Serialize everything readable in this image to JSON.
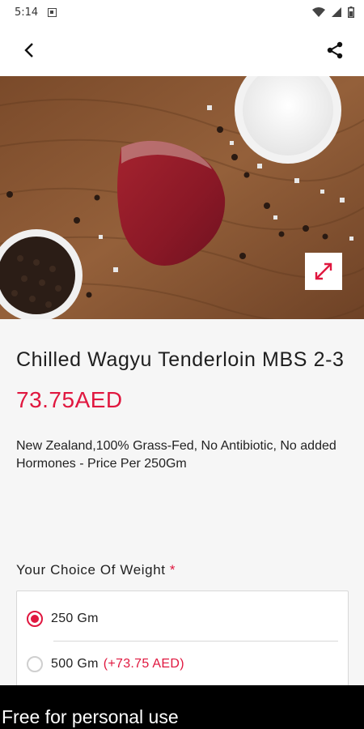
{
  "status_bar": {
    "time": "5:14",
    "icons": [
      "notification-icon",
      "wifi-icon",
      "signal-icon",
      "battery-icon"
    ]
  },
  "app_bar": {
    "back_icon": "arrow-back-icon",
    "share_icon": "share-icon"
  },
  "hero": {
    "image_subject": "raw wagyu tenderloin on wooden board with sea salt and black peppercorns",
    "expand_icon": "expand-icon"
  },
  "product": {
    "title": "Chilled Wagyu Tenderloin MBS 2-3",
    "price": "73.75AED",
    "description": "New Zealand,100% Grass-Fed, No Antibiotic, No added Hormones - Price Per 250Gm"
  },
  "weight_choice": {
    "label": "Your Choice Of Weight",
    "required_mark": "*",
    "options": [
      {
        "label": "250 Gm",
        "extra": "",
        "selected": true
      },
      {
        "label": "500 Gm",
        "extra": "(+73.75 AED)",
        "selected": false
      }
    ]
  },
  "watermark": {
    "text": "Free for personal use"
  },
  "colors": {
    "accent": "#e0173f",
    "background": "#f6f6f6",
    "surface": "#ffffff"
  }
}
